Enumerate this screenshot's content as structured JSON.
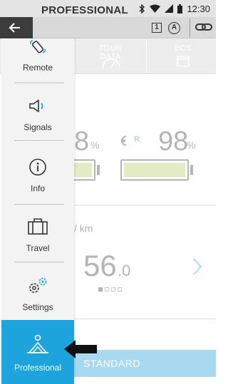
{
  "status_bar": {
    "time": "12:30",
    "icons": [
      "bluetooth-icon",
      "wifi-icon",
      "signal-icon",
      "battery-icon"
    ]
  },
  "app_bar": {
    "title": "PROFESSIONAL",
    "mode_number": "1",
    "mode_letter": "A",
    "back_icon": "back-arrow-icon",
    "link_icon": "chain-link-icon"
  },
  "dashboard": {
    "tabs": [
      "TOUR DATA",
      "ECS"
    ],
    "value_left": "8",
    "unit_left": "%",
    "value_right": "98",
    "unit_right": "%",
    "remote_badge": "R",
    "speed_unit": "/ km",
    "speed_value": "56",
    "speed_decimal": ".0",
    "bottom_button": "STANDARD"
  },
  "drawer": {
    "items": [
      {
        "label": "Remote",
        "icon": "remote-icon",
        "active": false
      },
      {
        "label": "Signals",
        "icon": "speaker-icon",
        "active": false
      },
      {
        "label": "Info",
        "icon": "info-icon",
        "active": false
      },
      {
        "label": "Travel",
        "icon": "suitcase-icon",
        "active": false
      },
      {
        "label": "Settings",
        "icon": "gears-icon",
        "active": false
      },
      {
        "label": "Professional",
        "icon": "professional-icon",
        "active": true
      }
    ]
  },
  "colors": {
    "accent": "#1ea4dc",
    "app_bar": "#d9d9d9",
    "drawer": "#f3f3f3",
    "battery_fill": "#e1ecc4"
  }
}
